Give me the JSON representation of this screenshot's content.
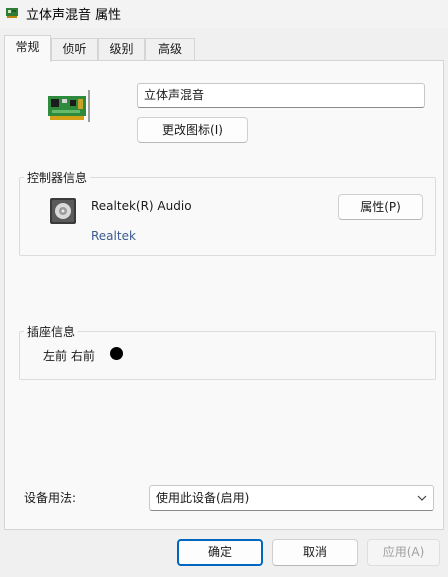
{
  "window": {
    "title": "立体声混音 属性",
    "icon": "audio-device-icon"
  },
  "tabs": [
    {
      "label": "常规",
      "active": true
    },
    {
      "label": "侦听",
      "active": false
    },
    {
      "label": "级别",
      "active": false
    },
    {
      "label": "高级",
      "active": false
    }
  ],
  "general": {
    "device_name": "立体声混音",
    "change_icon_button": "更改图标(I)",
    "controller": {
      "group_title": "控制器信息",
      "name": "Realtek(R) Audio",
      "vendor": "Realtek",
      "properties_button": "属性(P)"
    },
    "jack": {
      "group_title": "插座信息",
      "label": "左前 右前",
      "jack_color": "#000000"
    },
    "usage": {
      "label": "设备用法:",
      "selected": "使用此设备(启用)"
    }
  },
  "footer": {
    "ok_button": "确定",
    "cancel_button": "取消",
    "apply_button": "应用(A)"
  },
  "colors": {
    "link": "#3c5a8f",
    "focus_border": "#0067c0",
    "disabled_text": "#a0a0a0"
  }
}
